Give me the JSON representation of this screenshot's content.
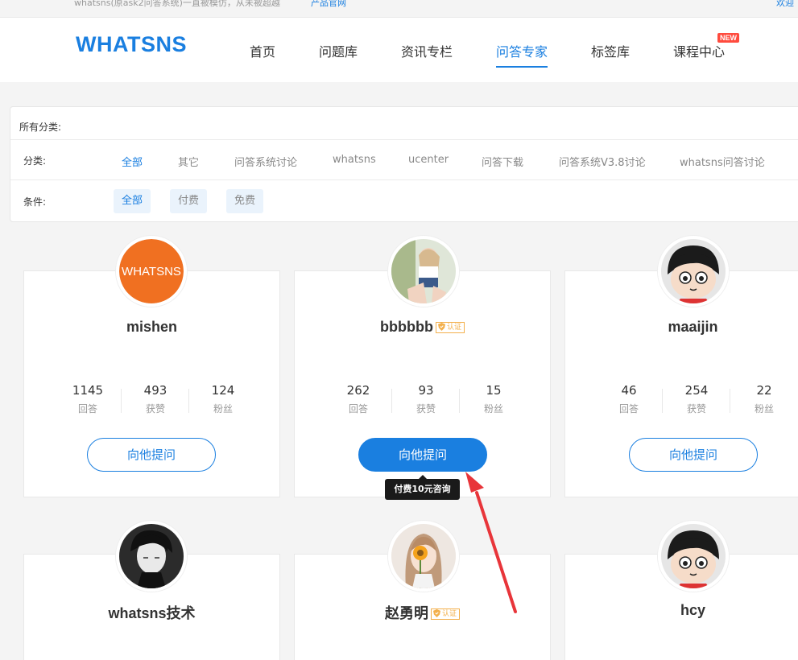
{
  "topbar": {
    "notice": "whatsns(原ask2问答系统)一直被模仿，从未被超越",
    "site_link": "产品官网",
    "welcome": "欢迎"
  },
  "header": {
    "logo": "WHATSNS",
    "nav": [
      "首页",
      "问题库",
      "资讯专栏",
      "问答专家",
      "标签库",
      "课程中心"
    ],
    "active_nav": "问答专家",
    "new_badge": "NEW"
  },
  "filter": {
    "title": "所有分类:",
    "category_label": "分类:",
    "categories": [
      "全部",
      "其它",
      "问答系统讨论",
      "whatsns",
      "ucenter",
      "问答下载",
      "问答系统V3.8讨论",
      "whatsns问答讨论"
    ],
    "condition_label": "条件:",
    "conditions": [
      "全部",
      "付费",
      "免费"
    ]
  },
  "experts": [
    {
      "name": "mishen",
      "verified": false,
      "answers": "1145",
      "likes": "493",
      "fans": "124",
      "button": "向他提问",
      "avatar": "whatsns-logo-avatar"
    },
    {
      "name": "bbbbbb",
      "verified": true,
      "answers": "262",
      "likes": "93",
      "fans": "15",
      "button": "向他提问",
      "avatar": "photo-avatar"
    },
    {
      "name": "maaijin",
      "verified": false,
      "answers": "46",
      "likes": "254",
      "fans": "22",
      "button": "向他提问",
      "avatar": "cartoon-avatar"
    },
    {
      "name": "whatsns技术",
      "verified": false,
      "avatar": "sketch-avatar"
    },
    {
      "name": "赵勇明",
      "verified": true,
      "avatar": "flower-girl-avatar"
    },
    {
      "name": "hcy",
      "verified": false,
      "avatar": "cartoon-avatar"
    }
  ],
  "labels": {
    "answers": "回答",
    "likes": "获赞",
    "fans": "粉丝",
    "verified": "认证"
  },
  "tooltip": "付费10元咨询",
  "colors": {
    "accent": "#1a7fe0",
    "badge": "#ff4b3e",
    "verify": "#f3b04c",
    "arrow": "#e8353a"
  }
}
